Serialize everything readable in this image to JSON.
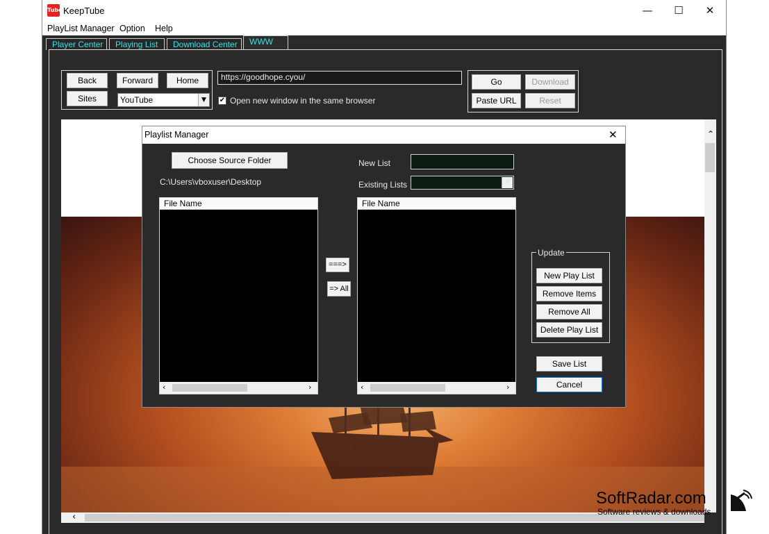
{
  "window": {
    "app_icon_text": "Tube",
    "title": "KeepTube",
    "minimize": "—",
    "maximize": "☐",
    "close": "✕"
  },
  "menubar": [
    "PlayList Manager",
    "Option",
    "Help"
  ],
  "tabs": [
    "Player Center",
    "Playing List",
    "Download Center",
    "WWW"
  ],
  "nav": {
    "back": "Back",
    "forward": "Forward",
    "home": "Home",
    "sites": "Sites",
    "site_selected": "YouTube",
    "url": "https://goodhope.cyou/",
    "same_window_label": "Open new window in the same browser",
    "go": "Go",
    "download": "Download",
    "paste_url": "Paste URL",
    "reset": "Reset"
  },
  "dialog": {
    "title": "Playlist Manager",
    "close": "✕",
    "choose_source": "Choose Source Folder",
    "source_path": "C:\\Users\\vboxuser\\Desktop",
    "new_list_label": "New List",
    "new_list_value": "",
    "existing_lists_label": "Existing Lists",
    "existing_lists_value": "",
    "left_header": "File Name",
    "right_header": "File Name",
    "move_one": "===>",
    "move_all": "=> All",
    "update_group": "Update",
    "new_play_list": "New Play List",
    "remove_items": "Remove Items",
    "remove_all": "Remove All",
    "delete_play_list": "Delete Play List",
    "save_list": "Save List",
    "cancel": "Cancel"
  },
  "watermark": {
    "brand": "SoftRadar.com",
    "tagline": "Software reviews & downloads"
  },
  "colors": {
    "tab_text": "#33e0e8",
    "app_dark": "#2a2a2a",
    "logo_red": "#e8221c"
  }
}
